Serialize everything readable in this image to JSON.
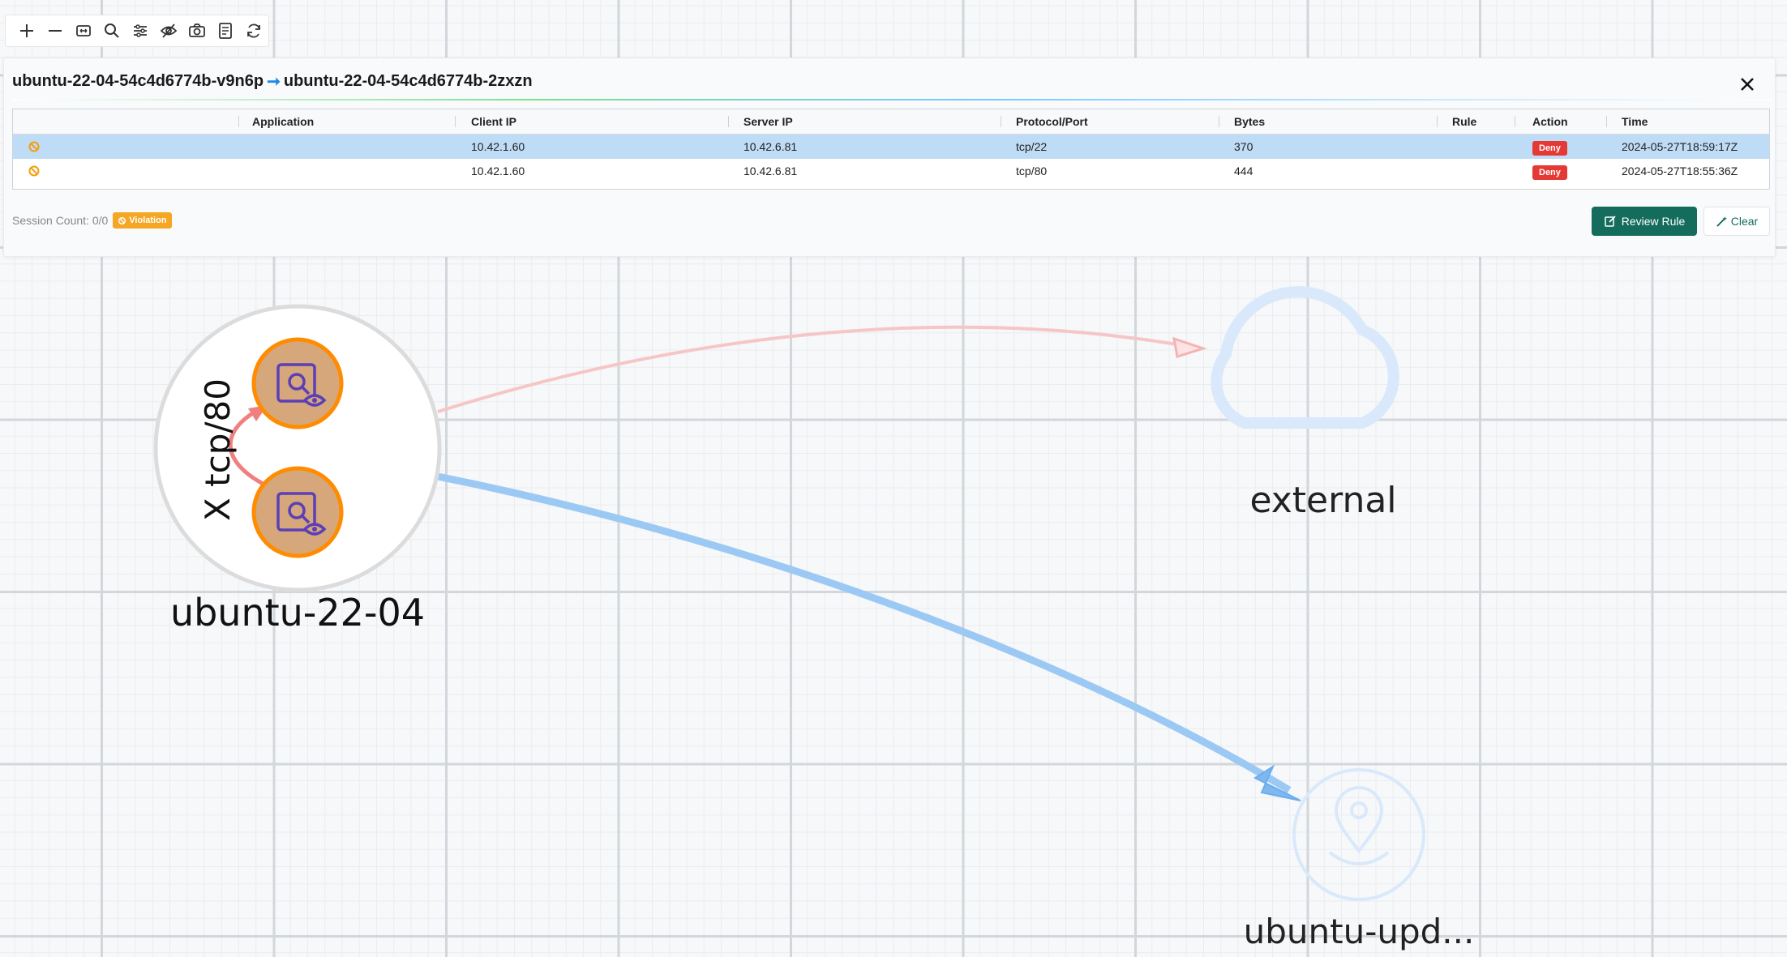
{
  "toolbar": {
    "tools": [
      "zoom-in",
      "zoom-out",
      "fit-view",
      "search",
      "filter-settings",
      "hide-toggle",
      "screenshot",
      "legend",
      "refresh"
    ]
  },
  "session_panel": {
    "source": "ubuntu-22-04-54c4d6774b-v9n6p",
    "destination": "ubuntu-22-04-54c4d6774b-2zxzn",
    "columns": [
      "Application",
      "Client IP",
      "Server IP",
      "Protocol/Port",
      "Bytes",
      "Rule",
      "Action",
      "Time"
    ],
    "rows": [
      {
        "application": "",
        "client_ip": "10.42.1.60",
        "server_ip": "10.42.6.81",
        "protocol_port": "tcp/22",
        "bytes": "370",
        "rule": "",
        "action": "Deny",
        "time": "2024-05-27T18:59:17Z"
      },
      {
        "application": "",
        "client_ip": "10.42.1.60",
        "server_ip": "10.42.6.81",
        "protocol_port": "tcp/80",
        "bytes": "444",
        "rule": "",
        "action": "Deny",
        "time": "2024-05-27T18:55:36Z"
      }
    ],
    "session_count": "Session Count: 0/0",
    "violation_label": "Violation",
    "review_rule_label": "Review Rule",
    "clear_label": "Clear"
  },
  "graph": {
    "group_label": "ubuntu-22-04",
    "edge_label": "X tcp/80",
    "external_label": "external",
    "update_label": "ubuntu-upd..."
  },
  "colors": {
    "node_fill": "#d6a77a",
    "node_border": "#ff8c00",
    "violation_edge": "#f08080",
    "allowed_edge": "#6aaeef",
    "deny": "#e53935",
    "primary_button": "#146c5c"
  }
}
